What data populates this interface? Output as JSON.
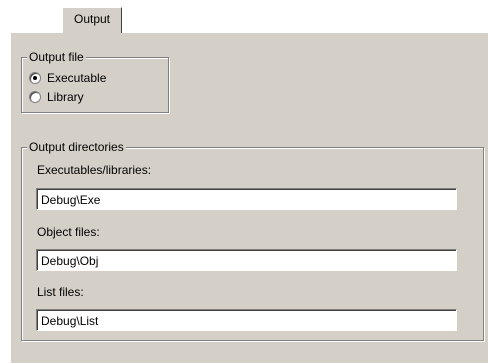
{
  "tab": {
    "label": "Output"
  },
  "output_file": {
    "title": "Output file",
    "options": [
      {
        "label": "Executable",
        "selected": true
      },
      {
        "label": "Library",
        "selected": false
      }
    ]
  },
  "output_directories": {
    "title": "Output directories",
    "fields": [
      {
        "label": "Executables/libraries:",
        "value": "Debug\\Exe"
      },
      {
        "label": "Object files:",
        "value": "Debug\\Obj"
      },
      {
        "label": "List files:",
        "value": "Debug\\List"
      }
    ]
  }
}
